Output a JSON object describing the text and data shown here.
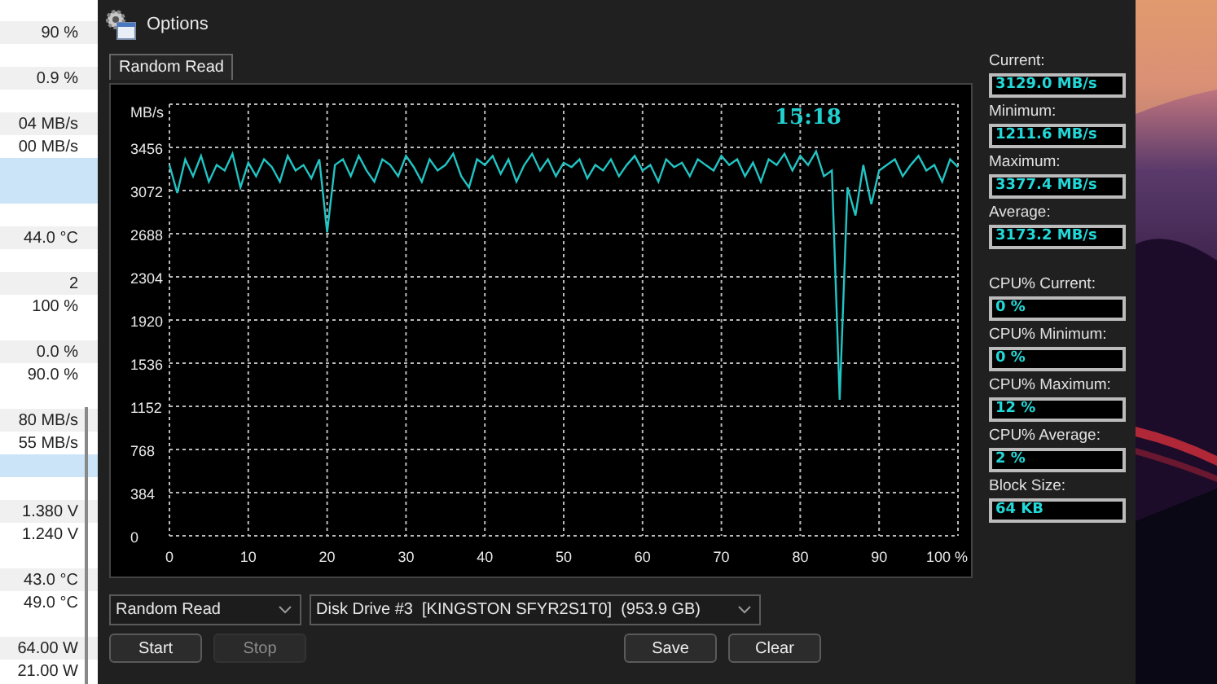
{
  "background_window": {
    "groups": [
      {
        "rows": [
          {
            "value": "90 %",
            "shaded": true,
            "highlighted": false
          }
        ]
      },
      {
        "rows": [
          {
            "value": "0.9 %",
            "shaded": true,
            "highlighted": false
          }
        ]
      },
      {
        "rows": [
          {
            "value": "04 MB/s",
            "shaded": true,
            "highlighted": false
          },
          {
            "value": "00 MB/s",
            "shaded": false,
            "highlighted": false
          },
          {
            "shaded": false,
            "highlighted": true
          },
          {
            "shaded": false,
            "highlighted": true
          }
        ]
      },
      {
        "rows": [
          {
            "value": "44.0 °C",
            "shaded": true,
            "highlighted": false
          }
        ]
      },
      {
        "rows": [
          {
            "value": "2",
            "shaded": true,
            "highlighted": false
          },
          {
            "value": "100 %",
            "shaded": false,
            "highlighted": false
          }
        ]
      },
      {
        "rows": [
          {
            "value": "0.0 %",
            "shaded": true,
            "highlighted": false
          },
          {
            "value": "90.0 %",
            "shaded": false,
            "highlighted": false
          }
        ]
      },
      {
        "rows": [
          {
            "value": "80 MB/s",
            "shaded": true,
            "highlighted": false
          },
          {
            "value": "55 MB/s",
            "shaded": false,
            "highlighted": false
          },
          {
            "shaded": false,
            "highlighted": true
          }
        ]
      },
      {
        "rows": [
          {
            "value": "1.380 V",
            "shaded": true,
            "highlighted": false
          },
          {
            "value": "1.240 V",
            "shaded": false,
            "highlighted": false
          }
        ]
      },
      {
        "rows": [
          {
            "value": "43.0 °C",
            "shaded": true,
            "highlighted": false
          },
          {
            "value": "49.0 °C",
            "shaded": false,
            "highlighted": false
          }
        ]
      },
      {
        "rows": [
          {
            "value": "64.00 W",
            "shaded": true,
            "highlighted": false
          },
          {
            "value": "21.00 W",
            "shaded": false,
            "highlighted": false
          }
        ]
      }
    ]
  },
  "window": {
    "title": "Options"
  },
  "tabs": [
    {
      "label": "Random Read",
      "selected": true
    }
  ],
  "graph": {
    "clock": "15:18",
    "chart_data": {
      "type": "line",
      "ylabel": "MB/s",
      "x": [
        0,
        1,
        2,
        3,
        4,
        5,
        6,
        7,
        8,
        9,
        10,
        11,
        12,
        13,
        14,
        15,
        16,
        17,
        18,
        19,
        20,
        21,
        22,
        23,
        24,
        25,
        26,
        27,
        28,
        29,
        30,
        31,
        32,
        33,
        34,
        35,
        36,
        37,
        38,
        39,
        40,
        41,
        42,
        43,
        44,
        45,
        46,
        47,
        48,
        49,
        50,
        51,
        52,
        53,
        54,
        55,
        56,
        57,
        58,
        59,
        60,
        61,
        62,
        63,
        64,
        65,
        66,
        67,
        68,
        69,
        70,
        71,
        72,
        73,
        74,
        75,
        76,
        77,
        78,
        79,
        80,
        81,
        82,
        83,
        84,
        85,
        86,
        87,
        88,
        89,
        90,
        91,
        92,
        93,
        94,
        95,
        96,
        97,
        98,
        99,
        100
      ],
      "series": [
        {
          "color": "#22c4c4",
          "values": [
            3300,
            3050,
            3350,
            3200,
            3380,
            3150,
            3300,
            3250,
            3400,
            3100,
            3320,
            3200,
            3350,
            3280,
            3150,
            3380,
            3250,
            3300,
            3180,
            3350,
            2700,
            3300,
            3350,
            3200,
            3380,
            3250,
            3150,
            3350,
            3300,
            3200,
            3380,
            3280,
            3150,
            3350,
            3250,
            3300,
            3400,
            3200,
            3100,
            3350,
            3300,
            3380,
            3220,
            3350,
            3150,
            3300,
            3400,
            3250,
            3350,
            3200,
            3320,
            3280,
            3350,
            3180,
            3300,
            3250,
            3350,
            3200,
            3300,
            3380,
            3250,
            3300,
            3150,
            3350,
            3280,
            3320,
            3200,
            3350,
            3300,
            3250,
            3380,
            3300,
            3350,
            3200,
            3320,
            3150,
            3350,
            3300,
            3400,
            3250,
            3380,
            3300,
            3420,
            3200,
            3250,
            1210,
            3100,
            2850,
            3300,
            2950,
            3250,
            3300,
            3350,
            3200,
            3300,
            3380,
            3250,
            3300,
            3150,
            3350,
            3280
          ]
        }
      ],
      "xlim": [
        0,
        100
      ],
      "ylim": [
        0,
        3840
      ],
      "grid": true,
      "xticks": [
        0,
        10,
        20,
        30,
        40,
        50,
        60,
        70,
        80,
        90,
        {
          "value": 100,
          "label": "100 %"
        }
      ],
      "yticks": [
        0,
        384,
        768,
        1152,
        1536,
        1920,
        2304,
        2688,
        3072,
        3456
      ]
    }
  },
  "controls": {
    "test_select": "Random Read",
    "drive_select": "Disk Drive #3  [KINGSTON SFYR2S1T0]  (953.9 GB)",
    "buttons": [
      {
        "label": "Start",
        "disabled": false
      },
      {
        "label": "Stop",
        "disabled": true
      },
      {
        "label": "Save",
        "disabled": false
      },
      {
        "label": "Clear",
        "disabled": false
      }
    ]
  },
  "stats": [
    {
      "label": "Current:",
      "value": "3129.0 MB/s"
    },
    {
      "label": "Minimum:",
      "value": "1211.6 MB/s"
    },
    {
      "label": "Maximum:",
      "value": "3377.4 MB/s"
    },
    {
      "label": "Average:",
      "value": "3173.2 MB/s"
    },
    {
      "label": "CPU% Current:",
      "value": "0 %"
    },
    {
      "label": "CPU% Minimum:",
      "value": "0 %"
    },
    {
      "label": "CPU% Maximum:",
      "value": "12 %"
    },
    {
      "label": "CPU% Average:",
      "value": "2 %"
    },
    {
      "label": "Block Size:",
      "value": "64 KB"
    }
  ]
}
